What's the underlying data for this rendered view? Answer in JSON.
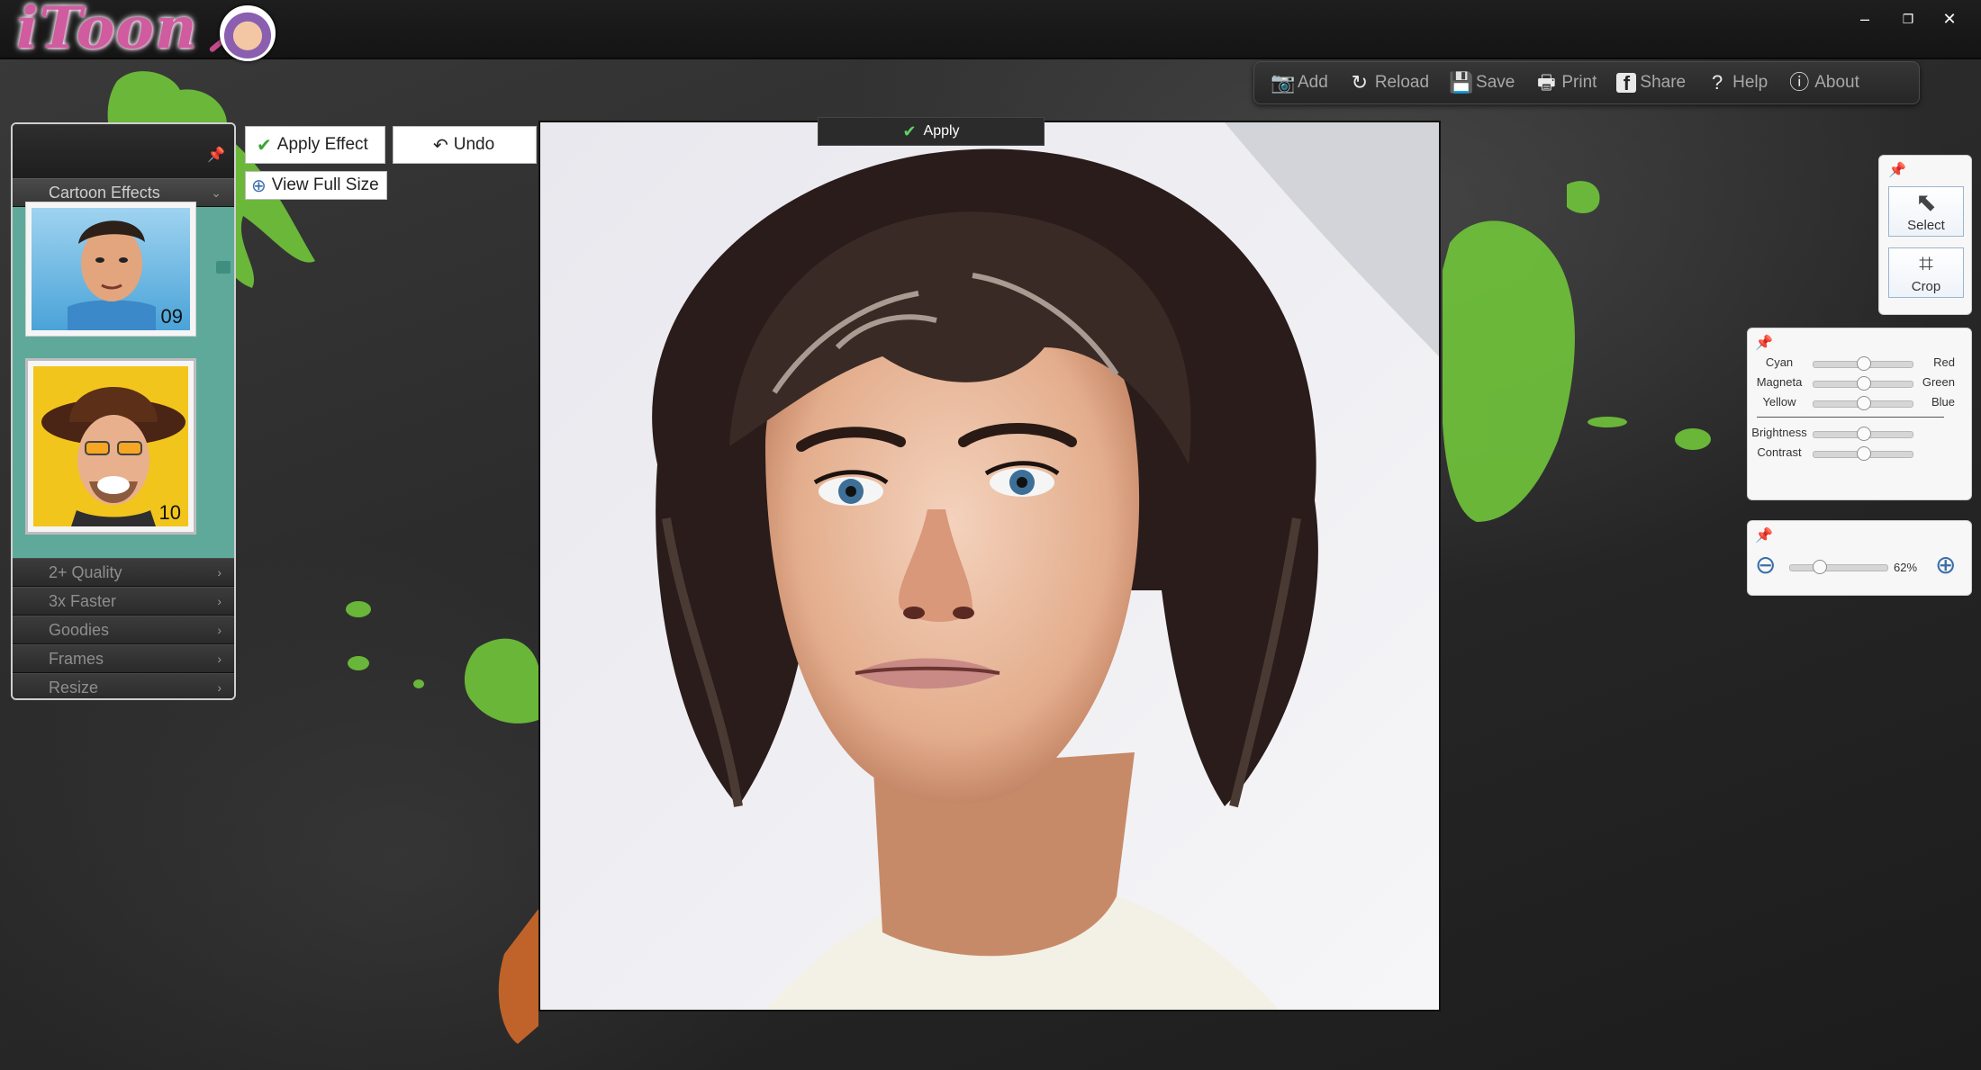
{
  "app": {
    "logo_text": "iToon"
  },
  "window_controls": {
    "minimize": "–",
    "restore": "❐",
    "close": "✕"
  },
  "toolbar": {
    "items": [
      {
        "label": "Add",
        "icon": "add-photo-icon",
        "glyph": "📷"
      },
      {
        "label": "Reload",
        "icon": "reload-icon",
        "glyph": "↻"
      },
      {
        "label": "Save",
        "icon": "save-icon",
        "glyph": "💾"
      },
      {
        "label": "Print",
        "icon": "print-icon",
        "glyph": "🖶"
      },
      {
        "label": "Share",
        "icon": "facebook-icon",
        "glyph": "f"
      },
      {
        "label": "Help",
        "icon": "help-icon",
        "glyph": "?"
      },
      {
        "label": "About",
        "icon": "info-icon",
        "glyph": "ⓘ"
      }
    ]
  },
  "left_panel": {
    "category": "Cartoon Effects",
    "thumbnails": [
      {
        "number": "09"
      },
      {
        "number": "10"
      }
    ],
    "menu": [
      "2+ Quality",
      "3x Faster",
      "Goodies",
      "Frames",
      "Resize"
    ]
  },
  "actions": {
    "apply_effect": "Apply Effect",
    "undo": "Undo",
    "view_full_size": "View Full Size"
  },
  "canvas": {
    "apply_label": "Apply"
  },
  "tools": {
    "select": "Select",
    "crop": "Crop"
  },
  "color_balance": {
    "rows": [
      {
        "left": "Cyan",
        "right": "Red",
        "value": 0.5
      },
      {
        "left": "Magneta",
        "right": "Green",
        "value": 0.5
      },
      {
        "left": "Yellow",
        "right": "Blue",
        "value": 0.5
      }
    ],
    "brightness": {
      "label": "Brightness",
      "value": 0.5
    },
    "contrast": {
      "label": "Contrast",
      "value": 0.5
    }
  },
  "zoom": {
    "value_text": "62%",
    "level": 0.3
  },
  "colors": {
    "accent_green": "#6fc23b",
    "panel_teal": "#5fa99a",
    "logo_pink": "#d05b9f"
  }
}
